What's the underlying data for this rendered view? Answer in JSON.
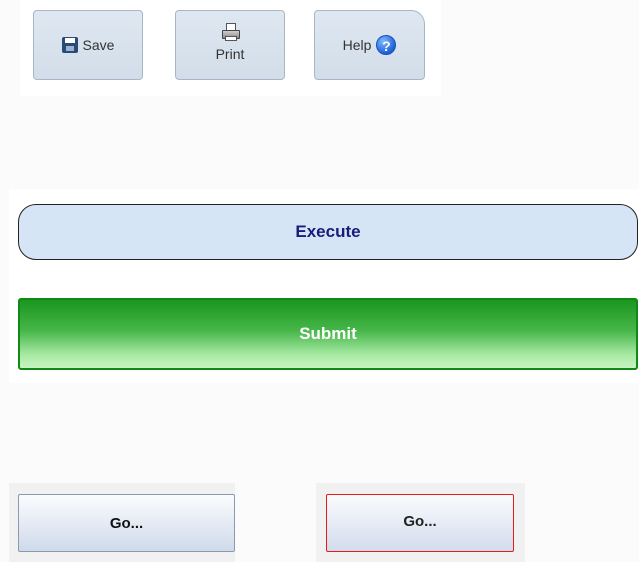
{
  "toolbar": {
    "save_label": "Save",
    "print_label": "Print",
    "help_label": "Help",
    "help_icon_glyph": "?",
    "icons": {
      "save": "floppy-disk-icon",
      "print": "printer-icon",
      "help": "help-question-icon"
    }
  },
  "panel": {
    "execute_label": "Execute",
    "submit_label": "Submit"
  },
  "go_buttons": {
    "primary_label": "Go...",
    "secondary_label": "Go..."
  },
  "colors": {
    "execute_text": "#1b1b7a",
    "submit_green": "#0f8a16",
    "go_focus_border": "#e31b1b"
  }
}
